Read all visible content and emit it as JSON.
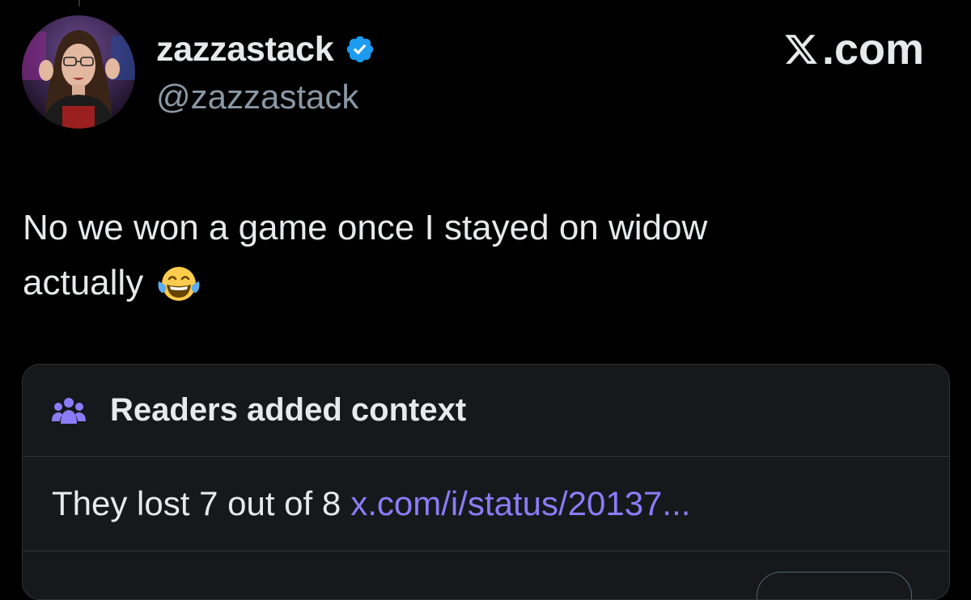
{
  "post": {
    "display_name": "zazzastack",
    "handle": "@zazzastack",
    "verified": true,
    "brand": {
      "logo": "x-logo-icon",
      "suffix": ".com"
    },
    "text_line1": "No we won a game once I stayed on widow",
    "text_line2": "actually",
    "emoji": "face-with-tears-of-joy"
  },
  "community_note": {
    "icon": "people-icon",
    "title": "Readers added context",
    "text": "They lost 7 out of 8",
    "link": "x.com/i/status/20137..."
  },
  "colors": {
    "background": "#000000",
    "text_primary": "#e7e9ea",
    "text_secondary": "#8b98a5",
    "verified": "#1d9bf0",
    "note_accent": "#8b7cf6",
    "card_background": "#16181c",
    "border": "#2f3336"
  }
}
